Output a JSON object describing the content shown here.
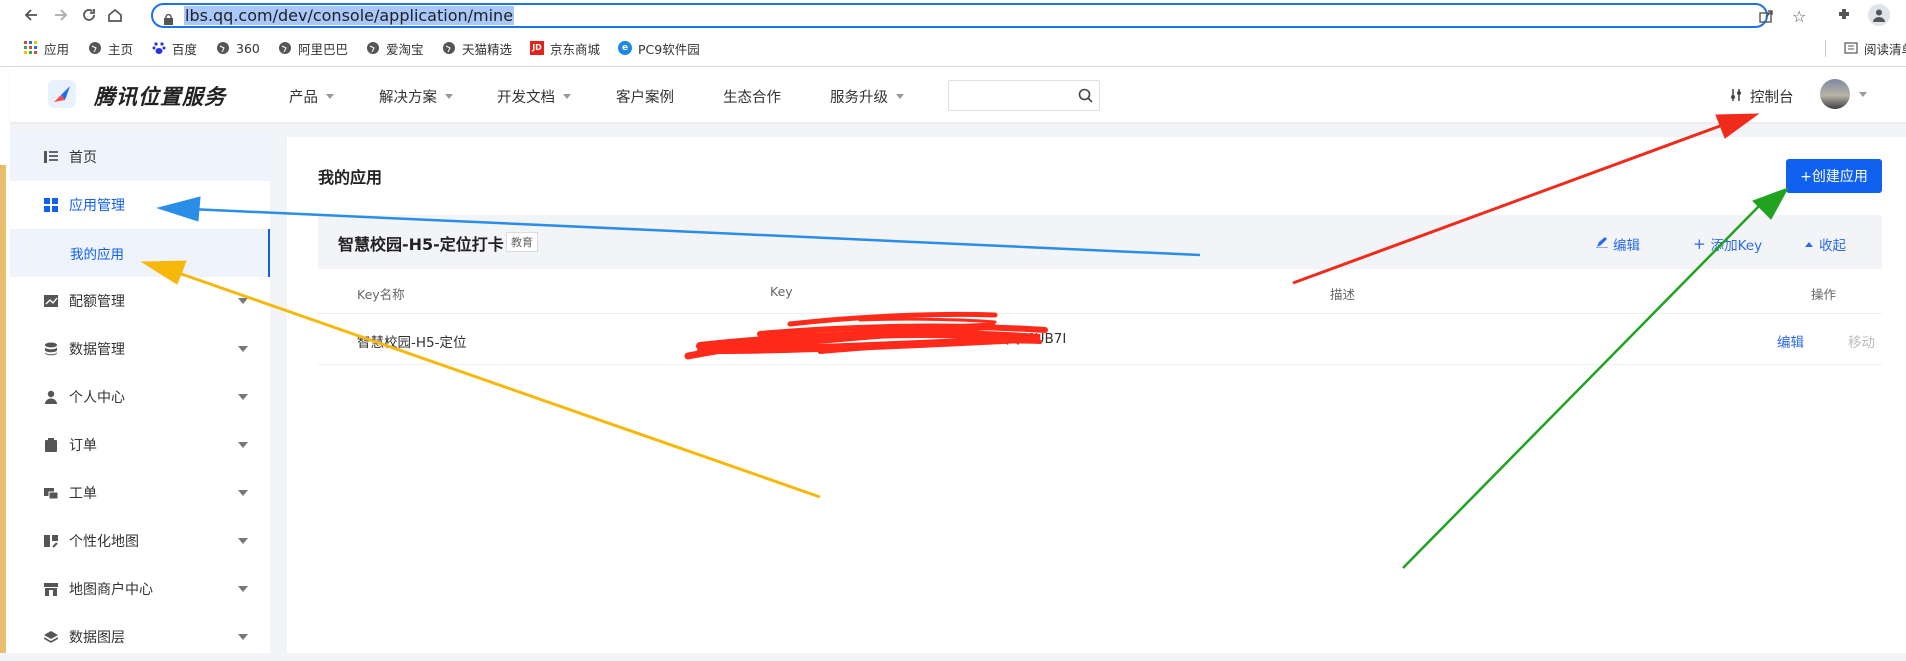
{
  "browser": {
    "url": "lbs.qq.com/dev/console/application/mine",
    "bookmarks": [
      {
        "label": "应用",
        "icon": "apps-grid-icon"
      },
      {
        "label": "主页",
        "icon": "globe-icon"
      },
      {
        "label": "百度",
        "icon": "baidu-paw-icon"
      },
      {
        "label": "360",
        "icon": "globe-icon"
      },
      {
        "label": "阿里巴巴",
        "icon": "globe-icon"
      },
      {
        "label": "爱淘宝",
        "icon": "globe-icon"
      },
      {
        "label": "天猫精选",
        "icon": "globe-icon"
      },
      {
        "label": "京东商城",
        "icon": "jd-logo-icon"
      },
      {
        "label": "PC9软件园",
        "icon": "pc9-logo-icon"
      }
    ],
    "reading_list": "阅读清单"
  },
  "header": {
    "brand": "腾讯位置服务",
    "nav": [
      "产品",
      "解决方案",
      "开发文档",
      "客户案例",
      "生态合作",
      "服务升级"
    ],
    "console_label": "控制台",
    "search_placeholder": ""
  },
  "sidebar": {
    "items": [
      {
        "label": "首页",
        "icon": "home-list-icon"
      },
      {
        "label": "应用管理",
        "icon": "apps-grid-icon"
      },
      {
        "label": "我的应用"
      },
      {
        "label": "配额管理",
        "icon": "quota-chart-icon"
      },
      {
        "label": "数据管理",
        "icon": "database-icon"
      },
      {
        "label": "个人中心",
        "icon": "user-icon"
      },
      {
        "label": "订单",
        "icon": "clipboard-icon"
      },
      {
        "label": "工单",
        "icon": "ticket-icon"
      },
      {
        "label": "个性化地图",
        "icon": "custom-map-icon"
      },
      {
        "label": "地图商户中心",
        "icon": "store-icon"
      },
      {
        "label": "数据图层",
        "icon": "layers-icon"
      }
    ]
  },
  "main": {
    "title": "我的应用",
    "create_button": "+创建应用",
    "app": {
      "name": "智慧校园-H5-定位打卡",
      "tag": "教育",
      "actions": {
        "edit": "编辑",
        "add_key": "添加Key",
        "collapse": "收起"
      }
    },
    "table": {
      "headers": [
        "Key名称",
        "Key",
        "描述",
        "操作"
      ],
      "rows": [
        {
          "name": "智慧校园-H5-定位",
          "key_visible": "-AQQ-6UB7I",
          "desc": "",
          "edit": "编辑",
          "move": "移动"
        }
      ]
    }
  },
  "colors": {
    "accent": "#1061f0",
    "link": "#2a6ae9",
    "arrow_blue": "#2a8de8",
    "arrow_red": "#f12b1b",
    "arrow_green": "#21a321",
    "arrow_orange": "#f6b90b",
    "scribble": "#ff2a1a"
  }
}
